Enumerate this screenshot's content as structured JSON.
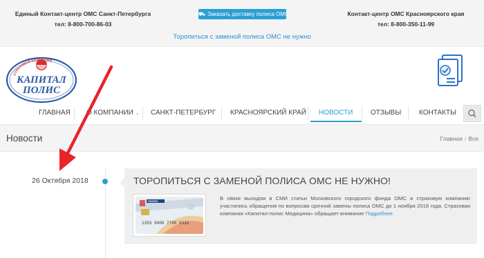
{
  "topbar": {
    "left_contact_title": "Единый Контакт-центр ОМС Санкт-Петербурга",
    "left_contact_phone": "тел: 8-800-700-86-03",
    "order_button": "Заказать доставку полиса ОМС",
    "right_contact_title": "Контакт-центр ОМС Красноярского края",
    "right_contact_phone": "тел: 8-800-350-11-99",
    "notice_link": "Торопиться с заменой полиса ОМС не нужно"
  },
  "logo": {
    "arc_text": "СТРАХОВАЯ КОМПАНИЯ",
    "line1": "КАПИТАЛ",
    "line2": "ПОЛИС"
  },
  "nav": {
    "items": [
      {
        "label": "ГЛАВНАЯ"
      },
      {
        "label": "О КОМПАНИИ"
      },
      {
        "label": "САНКТ-ПЕТЕРБУРГ"
      },
      {
        "label": "КРАСНОЯРСКИЙ КРАЙ"
      },
      {
        "label": "НОВОСТИ"
      },
      {
        "label": "ОТЗЫВЫ"
      },
      {
        "label": "КОНТАКТЫ"
      }
    ],
    "active_index": 4
  },
  "page": {
    "title": "Новости",
    "breadcrumb": [
      "Главная",
      "Все"
    ]
  },
  "post": {
    "date": "26 Октября 2018",
    "title": "ТОРОПИТЬСЯ С ЗАМЕНОЙ ПОЛИСА ОМС НЕ НУЖНО!",
    "text": "В связи выходом в СМИ статьи Московского городского фонда ОМС в страховую компанию участились обращения по вопросам срочной замены полиса ОМС до 1 ноября 2018 года. Страховая компания «Капитал-полис Медицина» обращает внимание",
    "more_link": "Подробнее",
    "card": {
      "label": "ПОЛИС",
      "number": "1353 9008 7700 0333"
    }
  },
  "colors": {
    "accent": "#2a9fd6",
    "arrow": "#e8232a",
    "logo_blue": "#2a5aa8",
    "logo_red": "#d62f2f"
  }
}
